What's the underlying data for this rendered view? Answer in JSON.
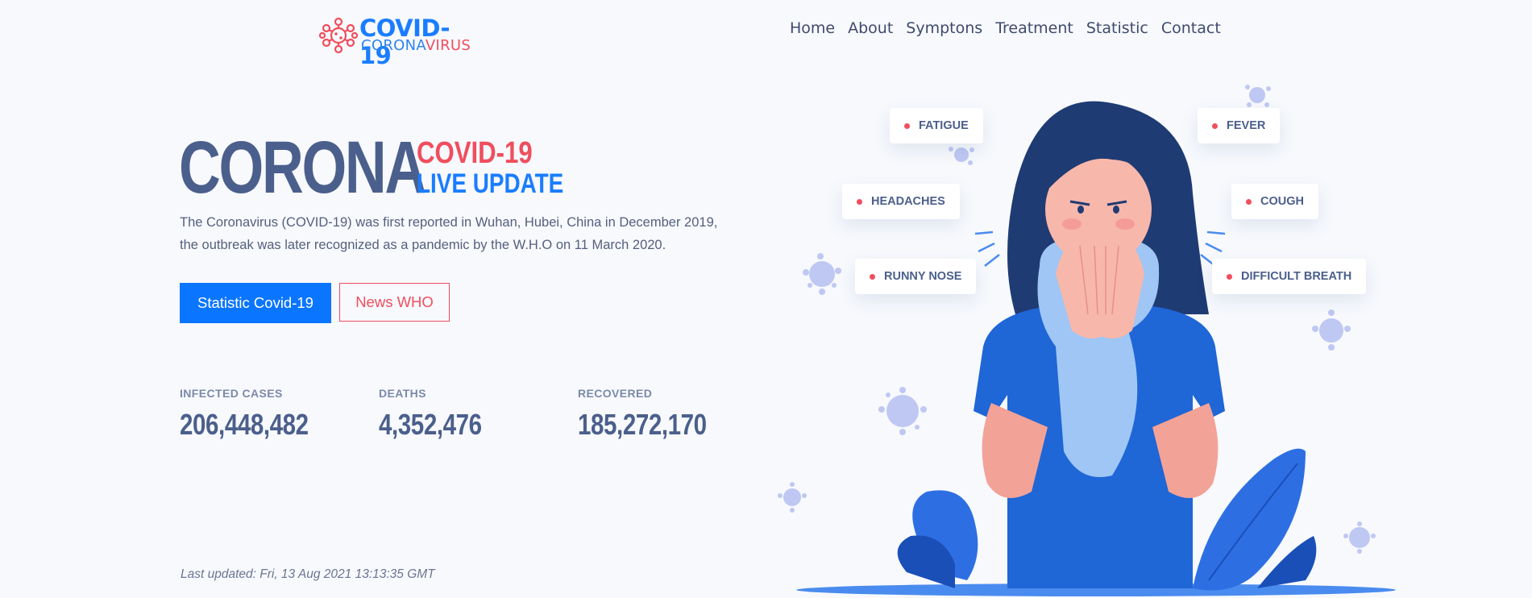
{
  "brand": {
    "line1": "COVID-19",
    "line2_part1": "CORONA",
    "line2_part2": "VIRUS",
    "icon": "virus-logo-icon"
  },
  "nav": {
    "items": [
      "Home",
      "About",
      "Symptons",
      "Treatment",
      "Statistic",
      "Contact"
    ]
  },
  "hero": {
    "title": "CORONA",
    "subtitle_1": "COVID-19",
    "subtitle_2": "LIVE UPDATE",
    "description": "The Coronavirus (COVID-19) was first reported in Wuhan, Hubei, China in December 2019, the outbreak was later recognized as a pandemic by the W.H.O on 11 March 2020.",
    "primary_button": "Statistic Covid-19",
    "secondary_button": "News WHO"
  },
  "stats": [
    {
      "label": "INFECTED CASES",
      "value": "206,448,482"
    },
    {
      "label": "DEATHS",
      "value": "4,352,476"
    },
    {
      "label": "RECOVERED",
      "value": "185,272,170"
    }
  ],
  "footer": {
    "last_updated": "Last updated: Fri, 13 Aug 2021 13:13:35 GMT"
  },
  "symptoms": [
    "FATIGUE",
    "FEVER",
    "HEADACHES",
    "COUGH",
    "RUNNY NOSE",
    "DIFFICULT BREATH"
  ],
  "colors": {
    "primary_blue": "#0a75ff",
    "accent_red": "#f04e5d",
    "heading_navy": "#4b5f8c",
    "background": "#f7f9fd"
  }
}
